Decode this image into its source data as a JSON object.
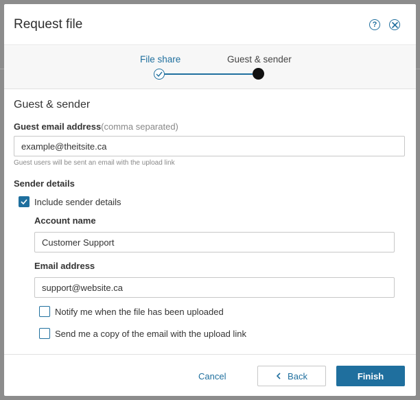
{
  "dialog": {
    "title": "Request file",
    "help_icon": "question-icon",
    "close_icon": "close-icon"
  },
  "stepper": {
    "steps": [
      {
        "label": "File share",
        "state": "completed"
      },
      {
        "label": "Guest & sender",
        "state": "current"
      }
    ]
  },
  "form": {
    "section_title": "Guest & sender",
    "guest_email": {
      "label": "Guest email address",
      "hint": "(comma separated)",
      "value": "example@theitsite.ca",
      "help": "Guest users will be sent an email with the upload link"
    },
    "sender_details": {
      "label": "Sender details",
      "include_checkbox": {
        "label": "Include sender details",
        "checked": true
      },
      "account_name": {
        "label": "Account name",
        "value": "Customer Support"
      },
      "email_address": {
        "label": "Email address",
        "value": "support@website.ca"
      },
      "notify_checkbox": {
        "label": "Notify me when the file has been uploaded",
        "checked": false
      },
      "copy_checkbox": {
        "label": "Send me a copy of the email with the upload link",
        "checked": false
      }
    }
  },
  "footer": {
    "cancel_label": "Cancel",
    "back_label": "Back",
    "finish_label": "Finish"
  },
  "colors": {
    "accent": "#1f6f9e",
    "overlay": "#8c8c8c"
  }
}
